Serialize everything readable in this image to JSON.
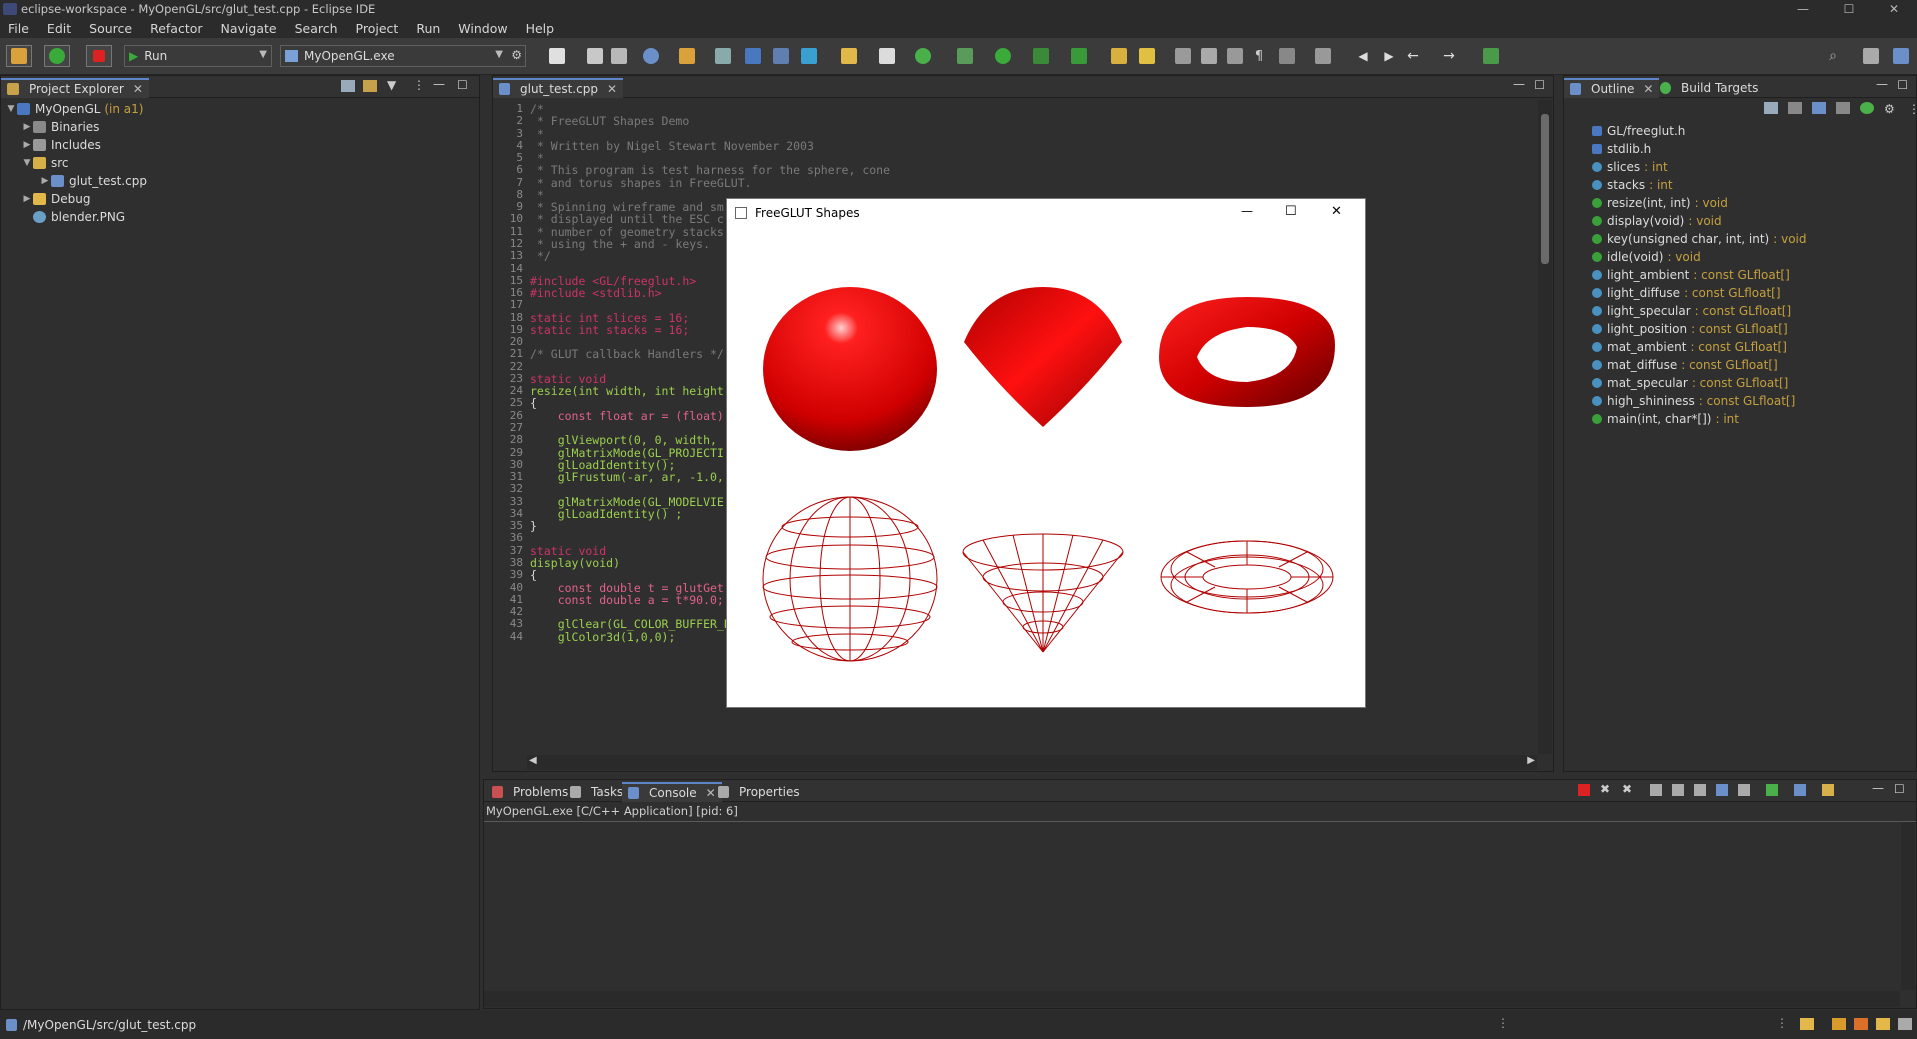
{
  "window": {
    "title": "eclipse-workspace - MyOpenGL/src/glut_test.cpp - Eclipse IDE",
    "minimize": "—",
    "maximize": "☐",
    "close": "✕"
  },
  "menu": [
    "File",
    "Edit",
    "Source",
    "Refactor",
    "Navigate",
    "Search",
    "Project",
    "Run",
    "Window",
    "Help"
  ],
  "toolbar": {
    "run_mode": "Run",
    "launch_target": "MyOpenGL.exe"
  },
  "project_explorer": {
    "tab_label": "Project Explorer",
    "project": "MyOpenGL",
    "project_suffix": "(in a1)",
    "items": [
      "Binaries",
      "Includes",
      "src",
      "glut_test.cpp",
      "Debug",
      "blender.PNG"
    ]
  },
  "editor": {
    "tab_label": "glut_test.cpp",
    "line_numbers": [
      "1",
      "2",
      "3",
      "4",
      "5",
      "6",
      "7",
      "8",
      "9",
      "10",
      "11",
      "12",
      "13",
      "14",
      "15",
      "16",
      "17",
      "18",
      "19",
      "20",
      "21",
      "22",
      "23",
      "24",
      "25",
      "26",
      "27",
      "28",
      "29",
      "30",
      "31",
      "32",
      "33",
      "34",
      "35",
      "36",
      "37",
      "38",
      "39",
      "40",
      "41",
      "42",
      "43",
      "44"
    ],
    "lines": [
      "/*",
      " * FreeGLUT Shapes Demo",
      " *",
      " * Written by Nigel Stewart November 2003",
      " *",
      " * This program is test harness for the sphere, cone",
      " * and torus shapes in FreeGLUT.",
      " *",
      " * Spinning wireframe and sm",
      " * displayed until the ESC c",
      " * number of geometry stacks",
      " * using the + and - keys.",
      " */",
      "",
      "#include <GL/freeglut.h>",
      "#include <stdlib.h>",
      "",
      "static int slices = 16;",
      "static int stacks = 16;",
      "",
      "/* GLUT callback Handlers */",
      "",
      "static void",
      "resize(int width, int height",
      "{",
      "    const float ar = (float)",
      "",
      "    glViewport(0, 0, width,",
      "    glMatrixMode(GL_PROJECTI",
      "    glLoadIdentity();",
      "    glFrustum(-ar, ar, -1.0,",
      "",
      "    glMatrixMode(GL_MODELVIE",
      "    glLoadIdentity() ;",
      "}",
      "",
      "static void",
      "display(void)",
      "{",
      "    const double t = glutGet",
      "    const double a = t*90.0;",
      "",
      "    glClear(GL_COLOR_BUFFER_BIT | GL_DEPTH_BUFFER_BIT);",
      "    glColor3d(1,0,0);"
    ]
  },
  "glut_window": {
    "title": "FreeGLUT Shapes",
    "minimize": "—",
    "maximize": "☐",
    "close": "✕"
  },
  "outline": {
    "tab_label": "Outline",
    "tab2_label": "Build Targets",
    "items": [
      {
        "name": "GL/freeglut.h",
        "type": ""
      },
      {
        "name": "stdlib.h",
        "type": ""
      },
      {
        "name": "slices",
        "type": ": int"
      },
      {
        "name": "stacks",
        "type": ": int"
      },
      {
        "name": "resize(int, int)",
        "type": ": void"
      },
      {
        "name": "display(void)",
        "type": ": void"
      },
      {
        "name": "key(unsigned char, int, int)",
        "type": ": void"
      },
      {
        "name": "idle(void)",
        "type": ": void"
      },
      {
        "name": "light_ambient",
        "type": ": const GLfloat[]"
      },
      {
        "name": "light_diffuse",
        "type": ": const GLfloat[]"
      },
      {
        "name": "light_specular",
        "type": ": const GLfloat[]"
      },
      {
        "name": "light_position",
        "type": ": const GLfloat[]"
      },
      {
        "name": "mat_ambient",
        "type": ": const GLfloat[]"
      },
      {
        "name": "mat_diffuse",
        "type": ": const GLfloat[]"
      },
      {
        "name": "mat_specular",
        "type": ": const GLfloat[]"
      },
      {
        "name": "high_shininess",
        "type": ": const GLfloat[]"
      },
      {
        "name": "main(int, char*[])",
        "type": ": int"
      }
    ]
  },
  "bottom_panel": {
    "tabs": [
      "Problems",
      "Tasks",
      "Console",
      "Properties"
    ],
    "console_header": "MyOpenGL.exe [C/C++ Application]  [pid: 6]"
  },
  "status": {
    "path": "/MyOpenGL/src/glut_test.cpp"
  },
  "colors": {
    "accent": "#5f85c9",
    "shape_red": "#e00000"
  }
}
